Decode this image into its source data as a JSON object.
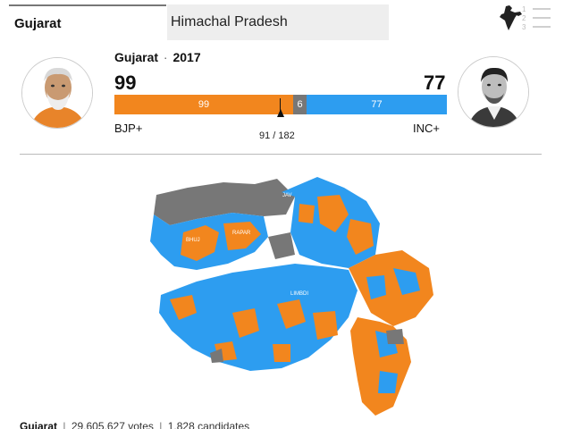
{
  "tabs": [
    {
      "label": "Gujarat",
      "active": true
    },
    {
      "label": "Himachal Pradesh",
      "active": false
    }
  ],
  "menu": {
    "items": [
      "1",
      "2",
      "3"
    ]
  },
  "header": {
    "state": "Gujarat",
    "separator": "·",
    "year": "2017",
    "left_total": "99",
    "right_total": "77",
    "left_party": "BJP+",
    "right_party": "INC+",
    "bar": {
      "bjp": "99",
      "others": "6",
      "inc": "77"
    },
    "majority": "91 / 182"
  },
  "colors": {
    "bjp": "#f2861e",
    "inc": "#2d9df0",
    "others": "#777777"
  },
  "map": {
    "labels": [
      "BHUJ",
      "RAPAR",
      "JAV",
      "LIMBDI"
    ]
  },
  "footer": {
    "state": "Gujarat",
    "votes": "29,605,627 votes",
    "candidates": "1,828 candidates"
  }
}
